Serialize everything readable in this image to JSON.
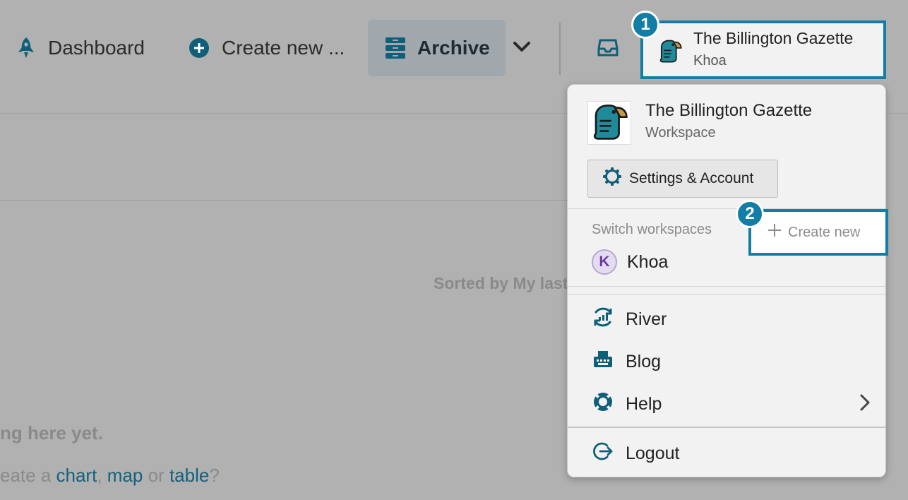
{
  "nav": {
    "dashboard": "Dashboard",
    "create_new": "Create new ...",
    "archive": "Archive"
  },
  "workspace_button": {
    "title": "The Billington Gazette",
    "subtitle": "Khoa"
  },
  "badges": {
    "one": "1",
    "two": "2"
  },
  "content": {
    "sorted_by": "Sorted by My last",
    "empty_title": "ng here yet.",
    "empty_hint_prefix": "eate a ",
    "link_chart": "chart",
    "comma": ", ",
    "link_map": "map",
    "or": " or ",
    "link_table": "table",
    "question": "?"
  },
  "dropdown": {
    "title": "The Billington Gazette",
    "subtitle": "Workspace",
    "settings_label": "Settings & Account",
    "switch_label": "Switch workspaces",
    "create_new_label": "Create new",
    "workspaces": [
      {
        "initial": "K",
        "name": "Khoa"
      }
    ],
    "items": {
      "river": "River",
      "blog": "Blog",
      "help": "Help",
      "logout": "Logout"
    }
  },
  "colors": {
    "accent": "#127ea5",
    "icon": "#0f5f78",
    "parrot_teal": "#1f8a9a",
    "parrot_beak": "#c49a4a"
  }
}
